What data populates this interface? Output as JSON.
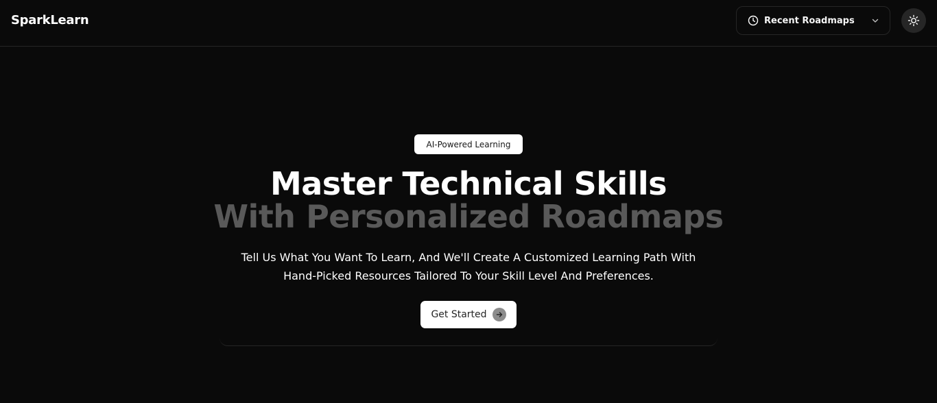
{
  "header": {
    "brand": "SparkLearn",
    "recent_roadmaps_label": "Recent Roadmaps",
    "icons": {
      "recent": "clock-icon",
      "dropdown": "chevron-down-icon",
      "theme": "sun-icon"
    }
  },
  "hero": {
    "badge": "AI-Powered Learning",
    "headline_line1": "Master Technical Skills",
    "headline_line2": "With Personalized Roadmaps",
    "subtitle_line1": "Tell Us What You Want To Learn, And We'll Create A Customized Learning Path With",
    "subtitle_line2": "Hand-Picked Resources Tailored To Your Skill Level And Preferences.",
    "cta_label": "Get Started",
    "cta_icon": "arrow-right-icon"
  },
  "colors": {
    "background": "#0a0a0a",
    "headline_primary": "#ffffff",
    "headline_secondary": "#595959",
    "border": "#262626"
  }
}
